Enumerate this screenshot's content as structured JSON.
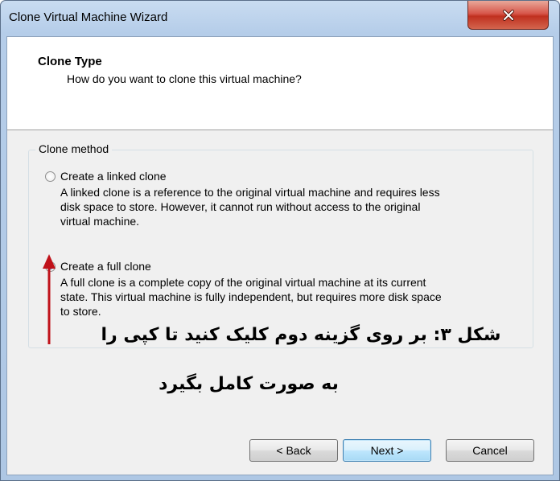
{
  "window": {
    "title": "Clone Virtual Machine Wizard",
    "close_icon": "close-icon"
  },
  "header": {
    "title": "Clone Type",
    "subtitle": "How do you want to clone this virtual machine?"
  },
  "clone_method": {
    "legend": "Clone method",
    "options": [
      {
        "label": "Create a linked clone",
        "selected": false,
        "description_lines": [
          "A linked clone is a reference to the original virtual machine and requires less",
          "disk space to store. However, it cannot run without access to the original",
          "virtual machine."
        ]
      },
      {
        "label": "Create a full clone",
        "selected": true,
        "description_lines": [
          "A full clone is a complete copy of the original virtual machine at its current",
          "state. This virtual machine is fully independent, but requires more disk space",
          "to store."
        ]
      }
    ]
  },
  "annotation": {
    "line1": "شکل ۳: بر روی گزینه دوم کلیک کنید تا کپی را",
    "line2": "به صورت کامل بگیرد",
    "arrow_color": "#c0121a"
  },
  "buttons": {
    "back": "< Back",
    "next": "Next >",
    "cancel": "Cancel"
  },
  "colors": {
    "title_bar": "#b5cde9",
    "close_button": "#c0301f",
    "radio_selected": "#2e7ad8"
  }
}
